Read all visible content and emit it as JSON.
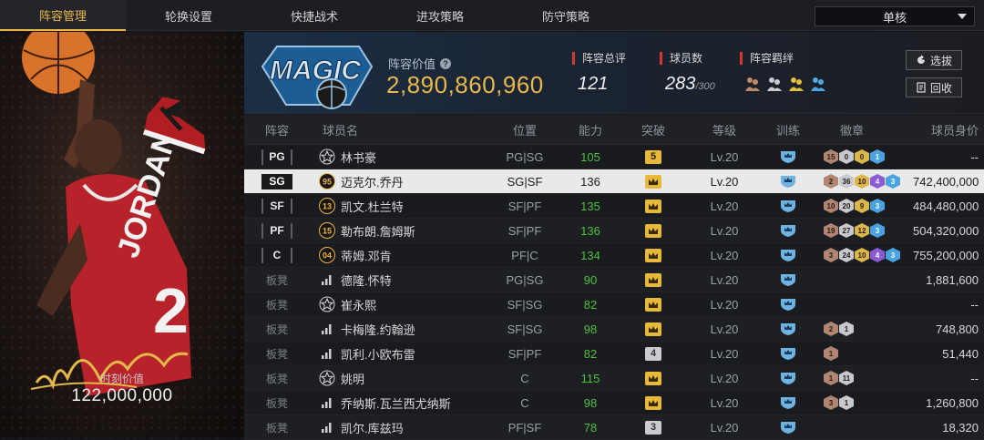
{
  "nav": {
    "tabs": [
      "阵容管理",
      "轮换设置",
      "快捷战术",
      "进攻策略",
      "防守策略"
    ],
    "mode": "单核"
  },
  "portrait": {
    "value_label": "时刻价值",
    "value": "122,000,000"
  },
  "team": {
    "lineup_value_label": "阵容价值",
    "lineup_value": "2,890,860,960",
    "rating_label": "阵容总评",
    "rating": "121",
    "players_label": "球员数",
    "players": "283",
    "players_max": "/300",
    "bond_label": "阵容羁绊",
    "scout_button": "选拔",
    "recycle_button": "回收"
  },
  "table": {
    "headers": [
      "阵容",
      "球员名",
      "位置",
      "能力",
      "突破",
      "等级",
      "训练",
      "徽章",
      "球员身价"
    ],
    "rows": [
      {
        "slot": "PG",
        "starter": true,
        "mark": "star",
        "name": "林书豪",
        "pos": "PG|SG",
        "ovr": "105",
        "green": true,
        "brk": "5",
        "brk_type": "num",
        "lvl": "Lv.20",
        "badges": [
          [
            "15",
            "bronze"
          ],
          [
            "0",
            "silver"
          ],
          [
            "0",
            "gold"
          ],
          [
            "1",
            "blue"
          ]
        ],
        "value": "--"
      },
      {
        "slot": "SG",
        "starter": true,
        "selected": true,
        "mark": "95",
        "name": "迈克尔.乔丹",
        "pos": "SG|SF",
        "ovr": "136",
        "green": false,
        "brk": "",
        "brk_type": "crown",
        "lvl": "Lv.20",
        "badges": [
          [
            "2",
            "bronze"
          ],
          [
            "36",
            "silver"
          ],
          [
            "10",
            "gold"
          ],
          [
            "4",
            "purple"
          ],
          [
            "3",
            "blue"
          ]
        ],
        "value": "742,400,000"
      },
      {
        "slot": "SF",
        "starter": true,
        "mark": "13",
        "name": "凯文.杜兰特",
        "pos": "SF|PF",
        "ovr": "135",
        "green": true,
        "brk": "",
        "brk_type": "crown",
        "lvl": "Lv.20",
        "badges": [
          [
            "10",
            "bronze"
          ],
          [
            "20",
            "silver"
          ],
          [
            "9",
            "gold"
          ],
          [
            "3",
            "blue"
          ]
        ],
        "value": "484,480,000"
      },
      {
        "slot": "PF",
        "starter": true,
        "mark": "15",
        "name": "勒布朗.詹姆斯",
        "pos": "SF|PF",
        "ovr": "136",
        "green": true,
        "brk": "",
        "brk_type": "crown",
        "lvl": "Lv.20",
        "badges": [
          [
            "19",
            "bronze"
          ],
          [
            "27",
            "silver"
          ],
          [
            "12",
            "gold"
          ],
          [
            "3",
            "blue"
          ]
        ],
        "value": "504,320,000"
      },
      {
        "slot": "C",
        "starter": true,
        "mark": "04",
        "name": "蒂姆.邓肯",
        "pos": "PF|C",
        "ovr": "134",
        "green": true,
        "brk": "",
        "brk_type": "crown",
        "lvl": "Lv.20",
        "badges": [
          [
            "3",
            "bronze"
          ],
          [
            "24",
            "silver"
          ],
          [
            "10",
            "gold"
          ],
          [
            "4",
            "purple"
          ],
          [
            "3",
            "blue"
          ]
        ],
        "value": "755,200,000"
      },
      {
        "slot": "板凳",
        "starter": false,
        "mark": "bars",
        "name": "德隆.怀特",
        "pos": "PG|SG",
        "ovr": "90",
        "green": true,
        "brk": "",
        "brk_type": "crown",
        "lvl": "Lv.20",
        "badges": [],
        "value": "1,881,600"
      },
      {
        "slot": "板凳",
        "starter": false,
        "mark": "star",
        "name": "崔永熙",
        "pos": "SF|SG",
        "ovr": "82",
        "green": true,
        "brk": "",
        "brk_type": "crown",
        "lvl": "Lv.20",
        "badges": [],
        "value": "--"
      },
      {
        "slot": "板凳",
        "starter": false,
        "mark": "bars",
        "name": "卡梅隆.约翰逊",
        "pos": "SF|SG",
        "ovr": "98",
        "green": true,
        "brk": "",
        "brk_type": "crown",
        "lvl": "Lv.20",
        "badges": [
          [
            "2",
            "bronze"
          ],
          [
            "1",
            "silver"
          ]
        ],
        "value": "748,800"
      },
      {
        "slot": "板凳",
        "starter": false,
        "mark": "bars",
        "name": "凯利.小欧布雷",
        "pos": "SF|PF",
        "ovr": "82",
        "green": true,
        "brk": "4",
        "brk_type": "grey",
        "lvl": "Lv.20",
        "badges": [
          [
            "1",
            "bronze"
          ]
        ],
        "value": "51,440"
      },
      {
        "slot": "板凳",
        "starter": false,
        "mark": "star",
        "name": "姚明",
        "pos": "C",
        "ovr": "115",
        "green": true,
        "brk": "",
        "brk_type": "crown",
        "lvl": "Lv.20",
        "badges": [
          [
            "1",
            "bronze"
          ],
          [
            "11",
            "silver"
          ]
        ],
        "value": "--"
      },
      {
        "slot": "板凳",
        "starter": false,
        "mark": "bars",
        "name": "乔纳斯.瓦兰西尤纳斯",
        "pos": "C",
        "ovr": "98",
        "green": true,
        "brk": "",
        "brk_type": "crown",
        "lvl": "Lv.20",
        "badges": [
          [
            "3",
            "bronze"
          ],
          [
            "1",
            "silver"
          ]
        ],
        "value": "1,260,800"
      },
      {
        "slot": "板凳",
        "starter": false,
        "mark": "bars",
        "name": "凯尔.库兹玛",
        "pos": "PF|SF",
        "ovr": "78",
        "green": true,
        "brk": "3",
        "brk_type": "grey",
        "lvl": "Lv.20",
        "badges": [],
        "value": "18,320"
      }
    ]
  },
  "colors": {
    "accent": "#e8b84a",
    "ovr_green": "#4fbf3e",
    "red_marker": "#d33a2f"
  }
}
